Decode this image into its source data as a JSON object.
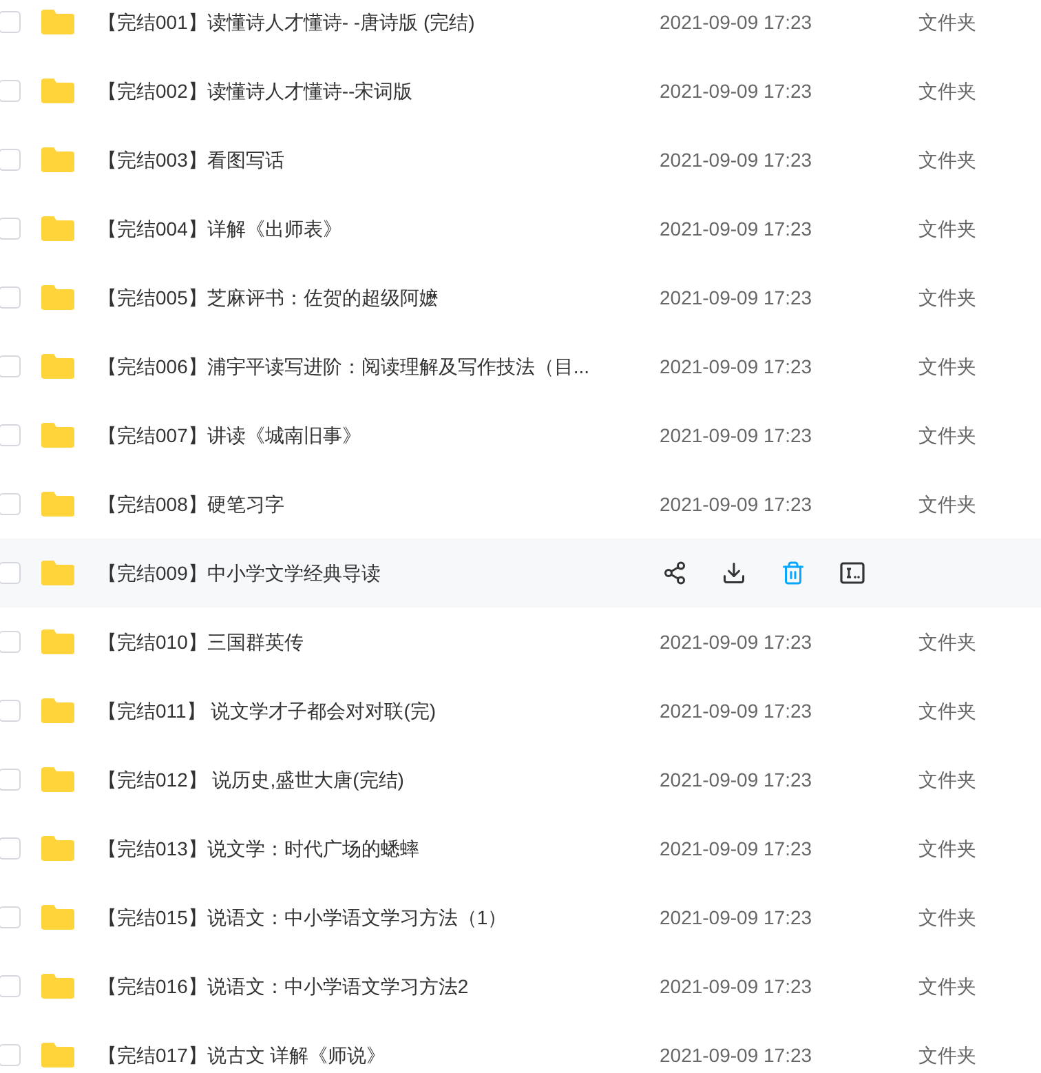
{
  "rows": [
    {
      "name": "【完结001】读懂诗人才懂诗- -唐诗版 (完结)",
      "date": "2021-09-09 17:23",
      "type": "文件夹",
      "checked": false,
      "hovered": false
    },
    {
      "name": "【完结002】读懂诗人才懂诗--宋词版",
      "date": "2021-09-09 17:23",
      "type": "文件夹",
      "checked": false,
      "hovered": false
    },
    {
      "name": "【完结003】看图写话",
      "date": "2021-09-09 17:23",
      "type": "文件夹",
      "checked": false,
      "hovered": false
    },
    {
      "name": "【完结004】详解《出师表》",
      "date": "2021-09-09 17:23",
      "type": "文件夹",
      "checked": false,
      "hovered": false
    },
    {
      "name": "【完结005】芝麻评书：佐贺的超级阿嬷",
      "date": "2021-09-09 17:23",
      "type": "文件夹",
      "checked": false,
      "hovered": false
    },
    {
      "name": "【完结006】浦宇平读写进阶：阅读理解及写作技法（目...",
      "date": "2021-09-09 17:23",
      "type": "文件夹",
      "checked": false,
      "hovered": false
    },
    {
      "name": "【完结007】讲读《城南旧事》",
      "date": "2021-09-09 17:23",
      "type": "文件夹",
      "checked": false,
      "hovered": false
    },
    {
      "name": "【完结008】硬笔习字",
      "date": "2021-09-09 17:23",
      "type": "文件夹",
      "checked": false,
      "hovered": false
    },
    {
      "name": "【完结009】中小学文学经典导读",
      "checked": false,
      "hovered": true
    },
    {
      "name": "【完结010】三国群英传",
      "date": "2021-09-09 17:23",
      "type": "文件夹",
      "checked": false,
      "hovered": false
    },
    {
      "name": "【完结011】 说文学才子都会对对联(完)",
      "date": "2021-09-09 17:23",
      "type": "文件夹",
      "checked": false,
      "hovered": false
    },
    {
      "name": "【完结012】 说历史,盛世大唐(完结)",
      "date": "2021-09-09 17:23",
      "type": "文件夹",
      "checked": false,
      "hovered": false
    },
    {
      "name": "【完结013】说文学：时代广场的蟋蟀",
      "date": "2021-09-09 17:23",
      "type": "文件夹",
      "checked": false,
      "hovered": false
    },
    {
      "name": "【完结015】说语文：中小学语文学习方法（1）",
      "date": "2021-09-09 17:23",
      "type": "文件夹",
      "checked": false,
      "hovered": false
    },
    {
      "name": "【完结016】说语文：中小学语文学习方法2",
      "date": "2021-09-09 17:23",
      "type": "文件夹",
      "checked": false,
      "hovered": false
    },
    {
      "name": "【完结017】说古文  详解《师说》",
      "date": "2021-09-09 17:23",
      "type": "文件夹",
      "checked": false,
      "hovered": false
    }
  ]
}
